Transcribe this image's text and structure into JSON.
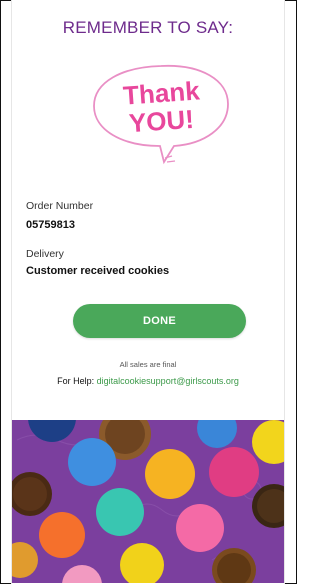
{
  "header": {
    "title": "REMEMBER TO SAY:"
  },
  "thank_you_graphic": {
    "line1": "Thank",
    "line2": "YOU!"
  },
  "order": {
    "label": "Order Number",
    "value": "05759813"
  },
  "delivery": {
    "label": "Delivery",
    "value": "Customer received cookies"
  },
  "done_button": {
    "label": "DONE"
  },
  "notice": {
    "text": "All sales are final"
  },
  "help": {
    "prefix": "For Help: ",
    "email": "digitalcookiesupport@girlscouts.org"
  },
  "colors": {
    "heading": "#6e2b8c",
    "button": "#4aa85a",
    "link": "#3c9a4a",
    "pattern_background": "#7b3f9e"
  },
  "icons": {
    "banner": "cookie-pattern-banner",
    "bubble": "speech-bubble-graphic"
  }
}
